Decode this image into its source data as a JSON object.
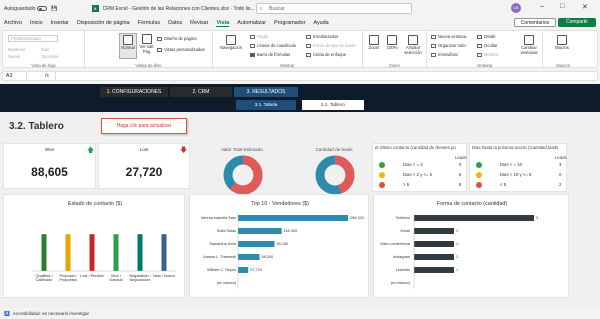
{
  "titlebar": {
    "autosave": "Autoguardado",
    "title": "CRM Excel - Gestión de las Relaciones con Clientes.xlsx  ·  Todo lis...",
    "search_placeholder": "Buscar",
    "user_initials": "LB"
  },
  "menu": {
    "items": [
      "Archivo",
      "Inicio",
      "Insertar",
      "Disposición de página",
      "Fórmulas",
      "Datos",
      "Revisar",
      "Vista",
      "Automatizar",
      "Programador",
      "Ayuda"
    ],
    "active": "Vista",
    "comments_label": "Comentarios",
    "share_label": "Compartir"
  },
  "ribbon": {
    "group_hoja": {
      "label": "Vista de hoja",
      "dropdown": "Predeterminado",
      "btn1": "Mantener",
      "btn2": "Salir",
      "btn3": "Nueva",
      "btn4": "Opciones"
    },
    "group_libro": {
      "label": "Vistas de libro",
      "normal": "Normal",
      "vista_salto": "Ver salt. Pág.",
      "diseno": "Diseño de página",
      "personalizadas": "Vistas personalizadas"
    },
    "group_mostrar": {
      "label": "Mostrar",
      "navegacion": "Navegación",
      "regla": "Regla",
      "lineas": "Líneas de cuadrícula",
      "barra": "Barra de fórmulas",
      "encabezados": "Encabezados",
      "focus": "Focus de tipo de datos",
      "celda": "Celda de enfoque"
    },
    "group_zoom": {
      "label": "Zoom",
      "zoom": "Zoom",
      "cien": "100%",
      "ampliar": "Ampliar selección"
    },
    "group_ventana": {
      "label": "Ventana",
      "nueva": "Nueva ventana",
      "organizar": "Organizar todo",
      "inmovilizar": "Inmovilizar",
      "dividir": "Dividir",
      "ocultar": "Ocultar",
      "mostrar": "Mostrar",
      "cambiar": "Cambiar ventanas"
    },
    "group_macros": {
      "label": "Macros",
      "macros": "Macros"
    }
  },
  "formula_bar": {
    "cell": "A3",
    "fx": "fx"
  },
  "nav": {
    "tabs": [
      "1. CONFIGURACIONES",
      "2. CRM",
      "3. RESULTADOS"
    ],
    "active_tab": "3. RESULTADOS",
    "subtabs": [
      "3.1. Tabela",
      "3.2. Tablero"
    ],
    "active_subtab": "3.2. Tablero"
  },
  "dashboard": {
    "title": "3.2. Tablero",
    "refresh_button": "Haga clic para actualizar",
    "kpi_won": {
      "label": "Won",
      "value": "88,605",
      "trend": "up"
    },
    "kpi_lost": {
      "label": "Lost",
      "value": "27,720",
      "trend": "down"
    },
    "donut_total": {
      "label": "Valor Total Estimado",
      "fraction": 0.62
    },
    "donut_leads": {
      "label": "Cantidad de leads",
      "fraction": 0.45
    },
    "table_contact": {
      "header": "el Último contacto (cantidad de clientes po",
      "col": "Leads",
      "rows": [
        {
          "label": "Dias < = 2",
          "value": "0",
          "color": "#2e9e4f"
        },
        {
          "label": "Dias > 2 y <= 5",
          "value": "6",
          "color": "#f2b705"
        },
        {
          "label": "> 5",
          "value": "8",
          "color": "#e74c3c"
        }
      ]
    },
    "table_next": {
      "header": "Dias hasta la próxima acción (Cantidad,leads",
      "col": "Leads",
      "rows": [
        {
          "label": "Dias > = 10",
          "value": "3",
          "color": "#2e9e4f"
        },
        {
          "label": "Dias < 10 y >= 5",
          "value": "0",
          "color": "#f2b705"
        },
        {
          "label": "< 5",
          "value": "2",
          "color": "#e74c3c"
        }
      ]
    },
    "status_chart_title": "Estado de contacto ($)",
    "vendors_chart_title": "Top 10 - Vendedores ($)",
    "contact_form_title": "Forma de contacto (cantidad)"
  },
  "chart_data": [
    {
      "type": "bar",
      "title": "Estado de contacto ($)",
      "categories": [
        "Qualified / Calificado",
        "Proposal / Propuesta",
        "Lost / Perdido",
        "Won / Ganado",
        "Negotiation / Negociación",
        "New / Nuevo"
      ],
      "values": [
        24,
        24,
        24,
        24,
        24,
        24
      ],
      "colors": [
        "#2e7d32",
        "#e6a500",
        "#c62828",
        "#2e9e4f",
        "#00796b",
        "#3a5f8f"
      ],
      "ylim": [
        0,
        30
      ]
    },
    {
      "type": "bar",
      "orientation": "horizontal",
      "title": "Top 10 - Vendedores ($)",
      "categories": [
        "Verena Isabella Sato",
        "Sofia Salas",
        "Samantha Ávila",
        "Joanna L. Trammell",
        "William C. Reyes",
        "(en blanco)"
      ],
      "values": [
        298320,
        118300,
        99150,
        58300,
        27720,
        0
      ],
      "value_labels": [
        "298,320",
        "118,300",
        "99,150",
        "58,300",
        "27,720",
        ""
      ],
      "color": "#2e8bad"
    },
    {
      "type": "bar",
      "orientation": "horizontal",
      "title": "Forma de contacto (cantidad)",
      "categories": [
        "Teléfono",
        "Email",
        "Video conferencia",
        "Instagram",
        "LinkedIn",
        "(en blanco)"
      ],
      "values": [
        3,
        1,
        1,
        1,
        1,
        0
      ],
      "value_labels": [
        "3",
        "1",
        "1",
        "1",
        "1",
        ""
      ],
      "color": "#2f3b3f"
    }
  ],
  "statusbar": {
    "accessibility": "Accesibilidad: es necesario investigar"
  }
}
